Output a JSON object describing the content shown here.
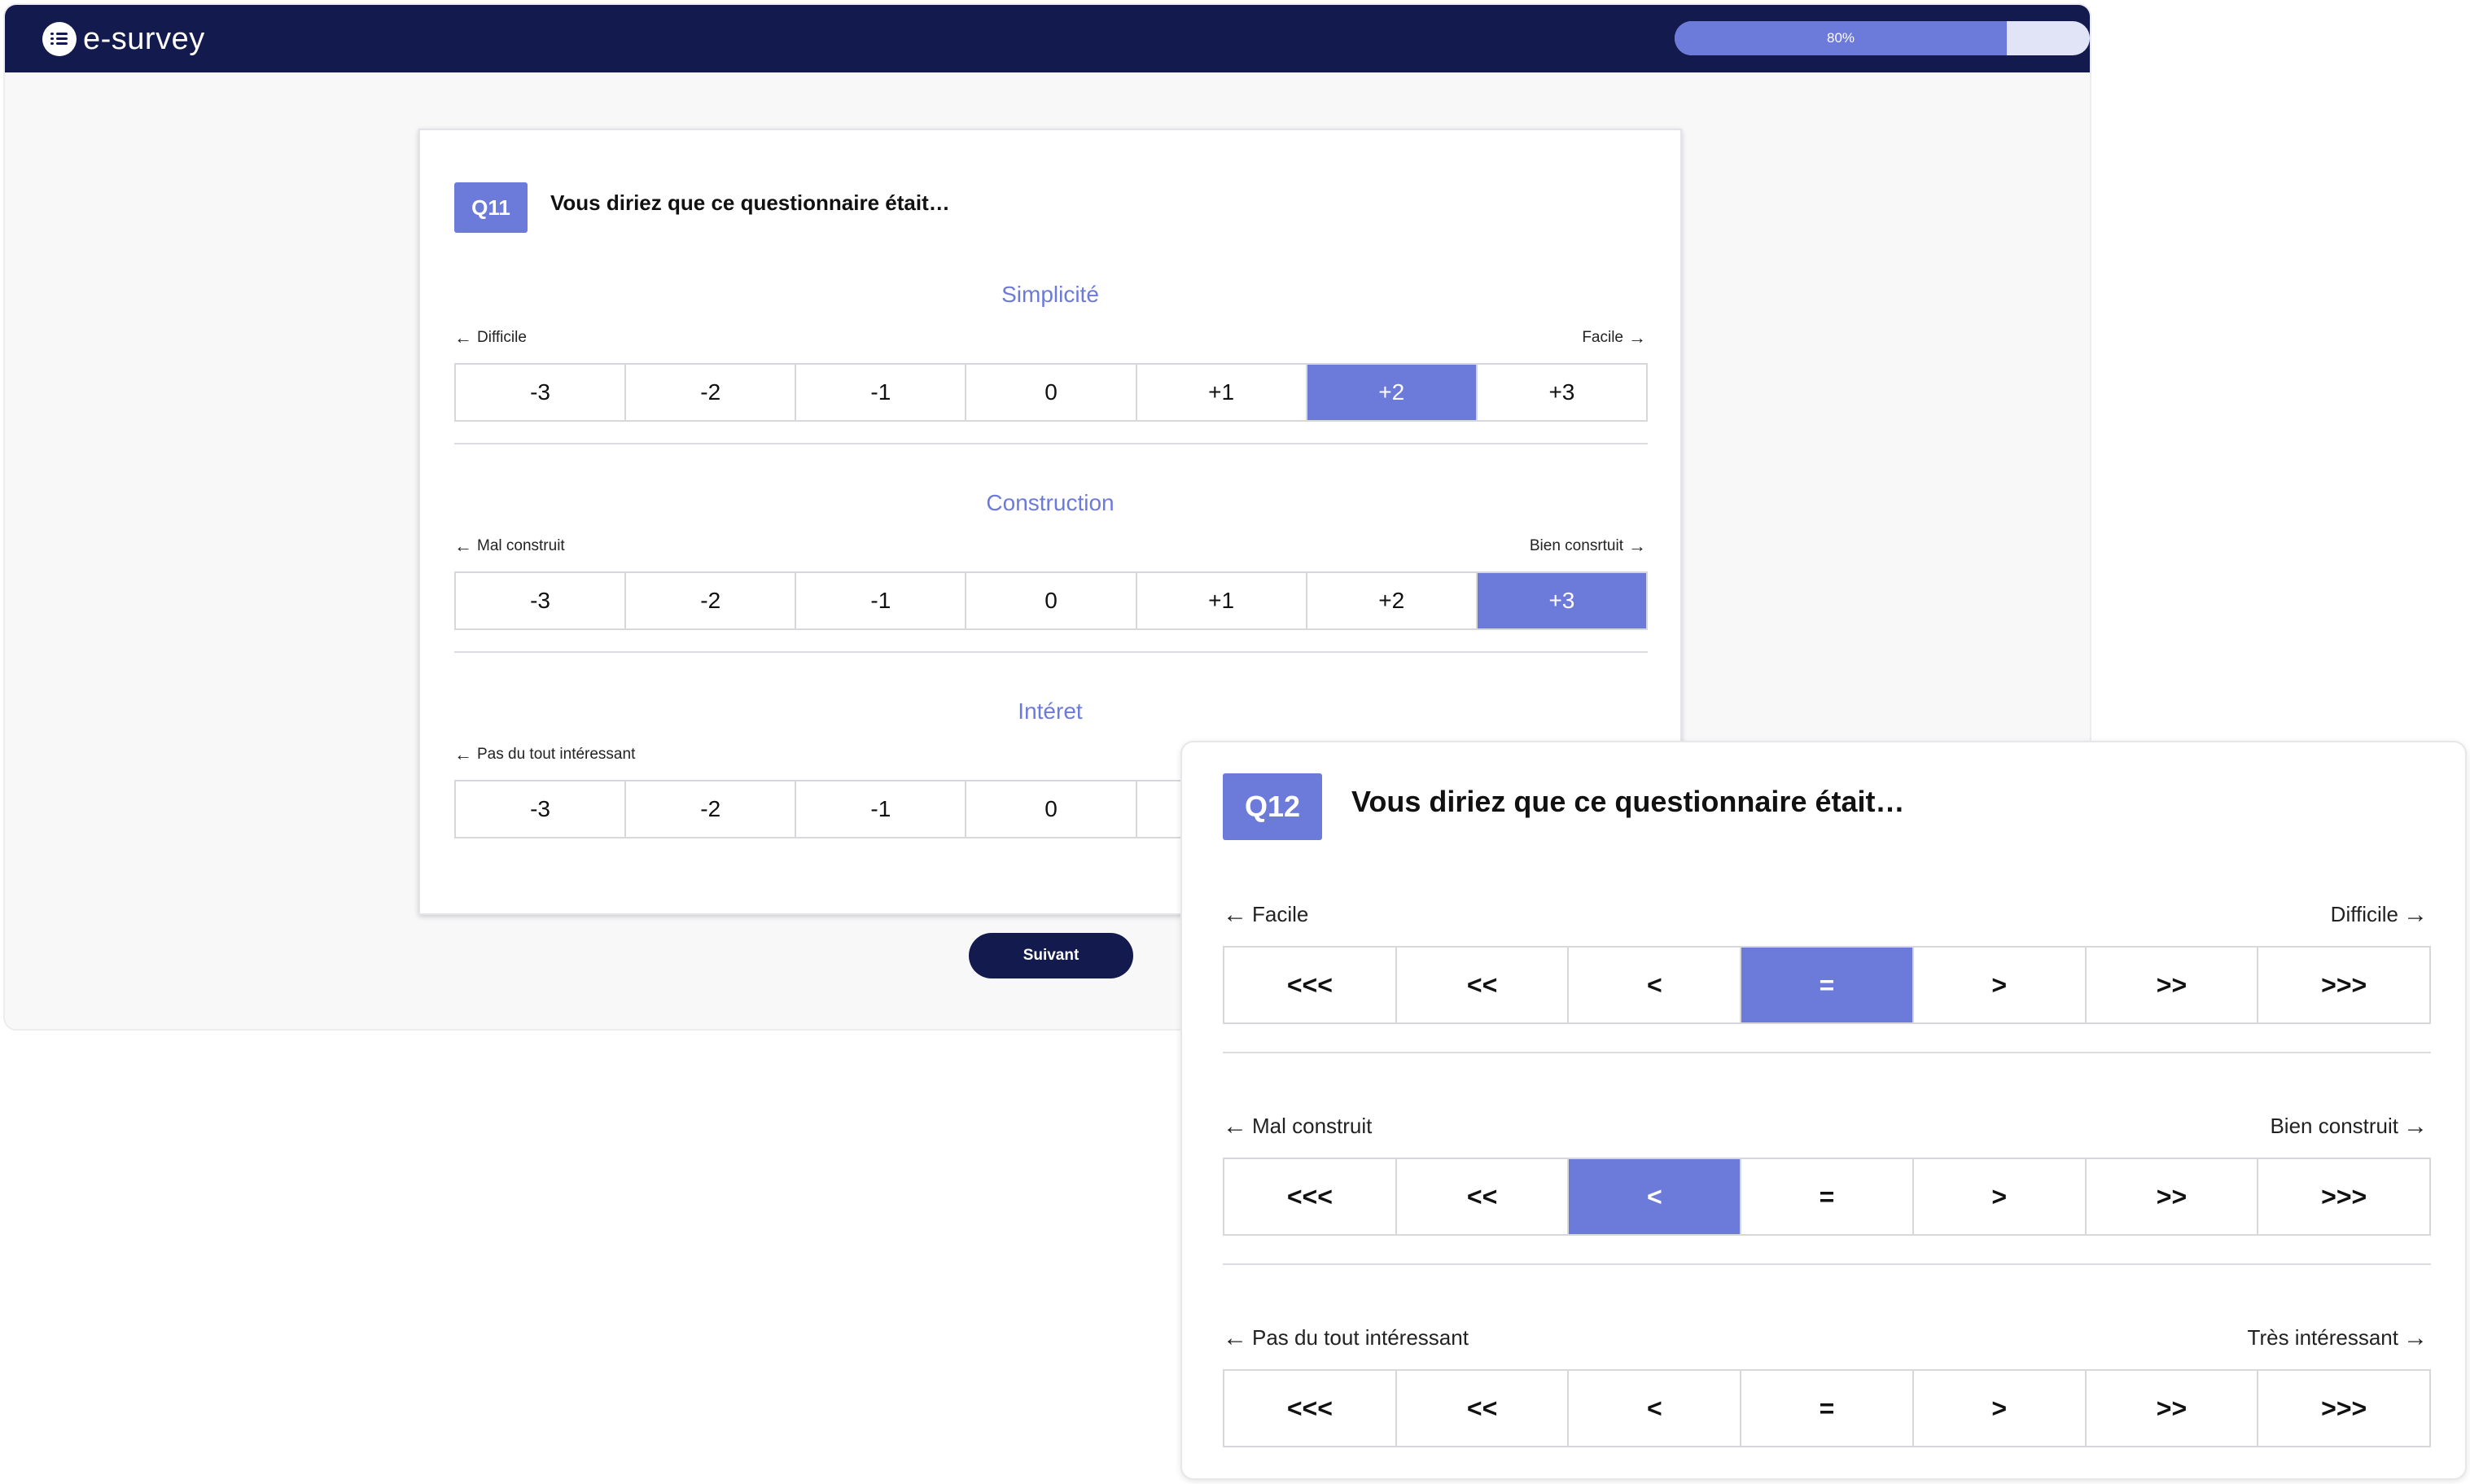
{
  "header": {
    "logo_text": "e-survey",
    "progress_label": "80%",
    "progress_value": 0.8
  },
  "q11": {
    "badge": "Q11",
    "title": "Vous diriez que ce questionnaire était…",
    "scales": [
      {
        "title": "Simplicité",
        "left": "Difficile",
        "right": "Facile",
        "options": [
          "-3",
          "-2",
          "-1",
          "0",
          "+1",
          "+2",
          "+3"
        ],
        "selected": 5
      },
      {
        "title": "Construction",
        "left": "Mal construit",
        "right": "Bien consrtuit",
        "options": [
          "-3",
          "-2",
          "-1",
          "0",
          "+1",
          "+2",
          "+3"
        ],
        "selected": 6
      },
      {
        "title": "Intéret",
        "left": "Pas du tout intéressant",
        "options": [
          "-3",
          "-2",
          "-1",
          "0",
          "",
          "",
          ""
        ],
        "selected": -1
      }
    ],
    "next_label": "Suivant"
  },
  "q12": {
    "badge": "Q12",
    "title": "Vous diriez que ce questionnaire était…",
    "scales": [
      {
        "left": "Facile",
        "right": "Difficile",
        "options": [
          "<<<",
          "<<",
          "<",
          "=",
          ">",
          ">>",
          ">>>"
        ],
        "selected": 3
      },
      {
        "left": "Mal construit",
        "right": "Bien construit",
        "options": [
          "<<<",
          "<<",
          "<",
          "=",
          ">",
          ">>",
          ">>>"
        ],
        "selected": 2
      },
      {
        "left": "Pas du tout intéressant",
        "right": "Très intéressant",
        "options": [
          "<<<",
          "<<",
          "<",
          "=",
          ">",
          ">>",
          ">>>"
        ],
        "selected": -1
      }
    ]
  },
  "colors": {
    "brand": "#131b4e",
    "accent": "#6c7ad9"
  }
}
